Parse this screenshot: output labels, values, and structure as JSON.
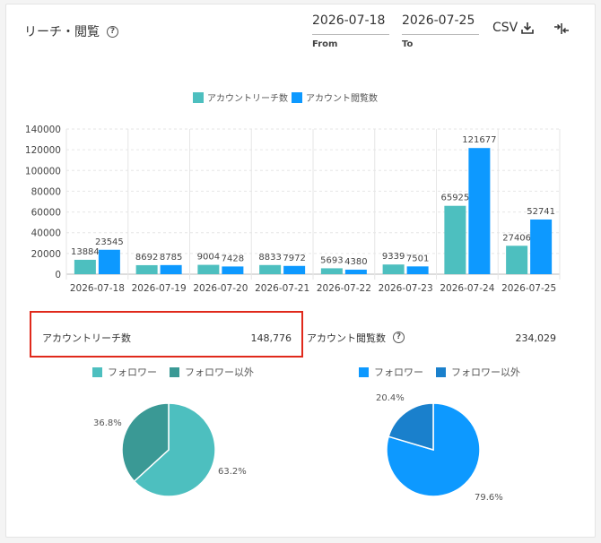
{
  "header": {
    "title": "リーチ・閲覧",
    "help_glyph": "?",
    "from_date": "2026-07-18",
    "from_label": "From",
    "to_date": "2026-07-25",
    "to_label": "To",
    "csv_label": "CSV"
  },
  "colors": {
    "reach": "#4dbfbf",
    "views": "#0d99ff",
    "follower_reach": "#4dbfbf",
    "nonfollower_reach": "#3a9995",
    "follower_views": "#0d99ff",
    "nonfollower_views": "#1a80cc",
    "highlight": "#e0291b"
  },
  "chart_data": {
    "type": "bar",
    "categories": [
      "2026-07-18",
      "2026-07-19",
      "2026-07-20",
      "2026-07-21",
      "2026-07-22",
      "2026-07-23",
      "2026-07-24",
      "2026-07-25"
    ],
    "series": [
      {
        "name": "アカウントリーチ数",
        "values": [
          13884,
          8692,
          9004,
          8833,
          5693,
          9339,
          65925,
          27406
        ]
      },
      {
        "name": "アカウント閲覧数",
        "values": [
          23545,
          8785,
          7428,
          7972,
          4380,
          7501,
          121677,
          52741
        ]
      }
    ],
    "ylim": [
      0,
      140000
    ],
    "yticks": [
      0,
      20000,
      40000,
      60000,
      80000,
      100000,
      120000,
      140000
    ],
    "grid": true,
    "legend": "top-center"
  },
  "stats": {
    "reach_label": "アカウントリーチ数",
    "reach_value": "148,776",
    "views_label": "アカウント閲覧数",
    "views_value": "234,029"
  },
  "pies": {
    "reach": {
      "legend": [
        "フォロワー",
        "フォロワー以外"
      ],
      "values": [
        63.2,
        36.8
      ],
      "labels": [
        "63.2%",
        "36.8%"
      ]
    },
    "views": {
      "legend": [
        "フォロワー",
        "フォロワー以外"
      ],
      "values": [
        79.6,
        20.4
      ],
      "labels": [
        "79.6%",
        "20.4%"
      ]
    }
  }
}
